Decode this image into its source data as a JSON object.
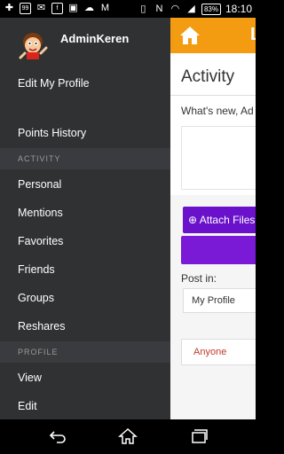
{
  "status_bar": {
    "left_icons": [
      "add-icon",
      "chat-icon",
      "email-icon",
      "facebook-icon",
      "image-icon",
      "cloud-upload-icon",
      "mail-icon"
    ],
    "right_icons": [
      "vibrate-icon",
      "nfc-icon",
      "wifi-icon",
      "signal-icon"
    ],
    "battery": "83%",
    "time": "18:10"
  },
  "drawer": {
    "username": "AdminKeren",
    "edit_profile": "Edit My Profile",
    "points_history": "Points History",
    "sections": {
      "activity": "ACTIVITY",
      "profile": "PROFILE"
    },
    "activity_items": [
      "Personal",
      "Mentions",
      "Favorites",
      "Friends",
      "Groups",
      "Reshares"
    ],
    "profile_items": [
      "View",
      "Edit"
    ]
  },
  "app": {
    "header_title": "L",
    "page_title": "Activity",
    "whats_new": "What's new, Ad",
    "attach_label": "Attach Files",
    "post_in_label": "Post in:",
    "post_in_value": "My Profile",
    "privacy_value": "Anyone",
    "colors": {
      "header": "#f39c12",
      "purple": "#7a19d6",
      "drawer": "#2f3133"
    }
  }
}
